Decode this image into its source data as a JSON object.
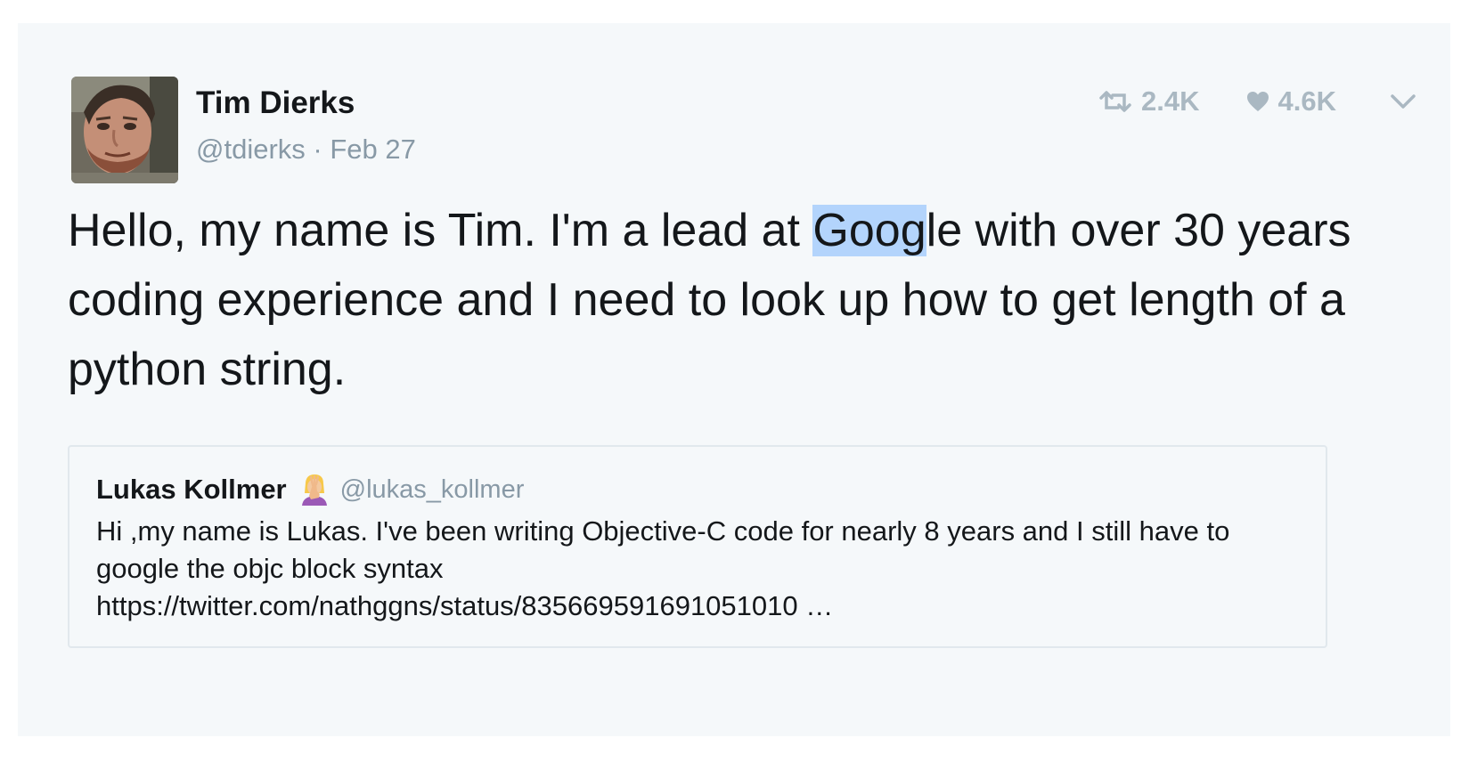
{
  "tweet": {
    "author_name": "Tim Dierks",
    "handle": "@tdierks",
    "separator": "·",
    "date": "Feb 27",
    "text_before": "Hello, my name is Tim. I'm a lead at ",
    "text_highlight": "Goog",
    "text_after": "le with over 30 years coding experience and I need to look up how to get length of a python string.",
    "retweets": "2.4K",
    "likes": "4.6K"
  },
  "quoted_tweet": {
    "author_name": "Lukas Kollmer",
    "handle": "@lukas_kollmer",
    "emoji": "facepalm-emoji",
    "text": "Hi ,my name is Lukas. I've been writing Objective-C code for nearly 8 years and I still have to google the objc block syntax",
    "link": "https://twitter.com/nathggns/status/835669591691051010 …"
  },
  "icons": {
    "retweet": "retweet-icon",
    "like": "heart-icon",
    "menu": "chevron-down-icon"
  },
  "colors": {
    "background": "#f5f8fa",
    "muted": "#8899a6",
    "action_icons": "#aab8c2",
    "highlight": "#b3d4fc",
    "text": "#14171a"
  }
}
